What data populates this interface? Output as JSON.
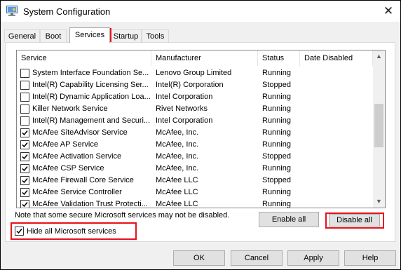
{
  "window": {
    "title": "System Configuration",
    "icon": "msconfig-icon",
    "close_glyph": "✕"
  },
  "tabs": [
    {
      "label": "General",
      "active": false
    },
    {
      "label": "Boot",
      "active": false
    },
    {
      "label": "Services",
      "active": true
    },
    {
      "label": "Startup",
      "active": false
    },
    {
      "label": "Tools",
      "active": false
    }
  ],
  "services": {
    "columns": [
      "Service",
      "Manufacturer",
      "Status",
      "Date Disabled"
    ],
    "rows": [
      {
        "checked": false,
        "service": "System Interface Foundation Se...",
        "manufacturer": "Lenovo Group Limited",
        "status": "Running",
        "date_disabled": ""
      },
      {
        "checked": false,
        "service": "Intel(R) Capability Licensing Ser...",
        "manufacturer": "Intel(R) Corporation",
        "status": "Stopped",
        "date_disabled": ""
      },
      {
        "checked": false,
        "service": "Intel(R) Dynamic Application Loa...",
        "manufacturer": "Intel Corporation",
        "status": "Running",
        "date_disabled": ""
      },
      {
        "checked": false,
        "service": "Killer Network Service",
        "manufacturer": "Rivet Networks",
        "status": "Running",
        "date_disabled": ""
      },
      {
        "checked": false,
        "service": "Intel(R) Management and Securi...",
        "manufacturer": "Intel Corporation",
        "status": "Running",
        "date_disabled": ""
      },
      {
        "checked": true,
        "service": "McAfee SiteAdvisor Service",
        "manufacturer": "McAfee, Inc.",
        "status": "Running",
        "date_disabled": ""
      },
      {
        "checked": true,
        "service": "McAfee AP Service",
        "manufacturer": "McAfee, Inc.",
        "status": "Running",
        "date_disabled": ""
      },
      {
        "checked": true,
        "service": "McAfee Activation Service",
        "manufacturer": "McAfee, Inc.",
        "status": "Stopped",
        "date_disabled": ""
      },
      {
        "checked": true,
        "service": "McAfee CSP Service",
        "manufacturer": "McAfee, Inc.",
        "status": "Running",
        "date_disabled": ""
      },
      {
        "checked": true,
        "service": "McAfee Firewall Core Service",
        "manufacturer": "McAfee LLC",
        "status": "Stopped",
        "date_disabled": ""
      },
      {
        "checked": true,
        "service": "McAfee Service Controller",
        "manufacturer": "McAfee LLC",
        "status": "Running",
        "date_disabled": ""
      },
      {
        "checked": true,
        "service": "McAfee Validation Trust Protecti...",
        "manufacturer": "McAfee LLC",
        "status": "Running",
        "date_disabled": ""
      }
    ]
  },
  "note": "Note that some secure Microsoft services may not be disabled.",
  "enable_all": {
    "label": "Enable all"
  },
  "disable_all": {
    "label": "Disable all"
  },
  "hide_microsoft": {
    "label": "Hide all Microsoft services",
    "checked": true
  },
  "footer": {
    "ok": "OK",
    "cancel": "Cancel",
    "apply": "Apply",
    "help": "Help"
  },
  "highlight_color": "#e8101c",
  "scroll_up_glyph": "▲",
  "scroll_down_glyph": "▼"
}
